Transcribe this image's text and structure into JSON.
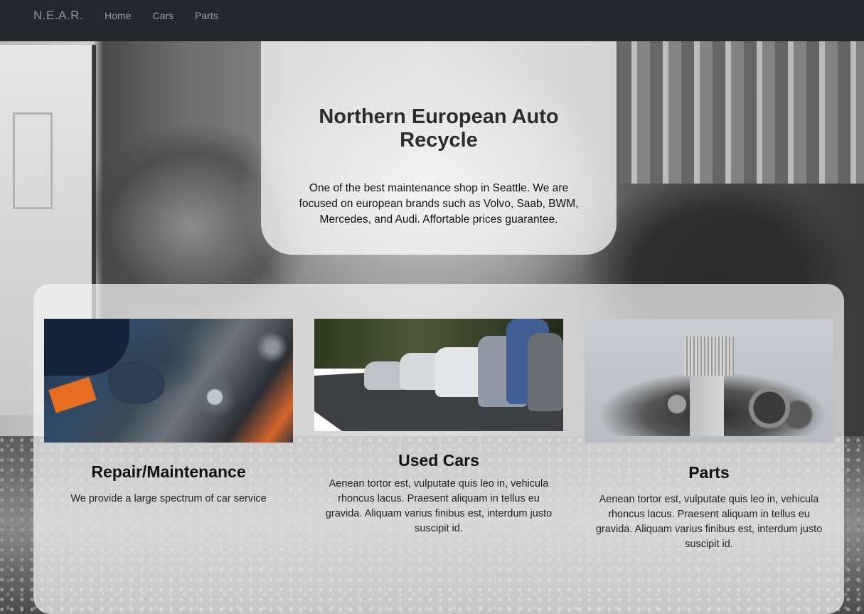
{
  "navbar": {
    "brand": "N.E.A.R.",
    "links": [
      "Home",
      "Cars",
      "Parts"
    ]
  },
  "hero": {
    "title": "Northern European Auto Recycle",
    "description": "One of the best maintenance shop in Seattle. We are focused on european brands such as Volvo, Saab, BWM, Mercedes, and Audi. Affortable prices guarantee."
  },
  "services": [
    {
      "title": "Repair/Maintenance",
      "text": "We provide a large spectrum of car service",
      "image": "engine-repair-photo"
    },
    {
      "title": "Used Cars",
      "text": "Aenean tortor est, vulputate quis leo in, vehicula rhoncus lacus. Praesent aliquam in tellus eu gravida. Aliquam varius finibus est, interdum justo suscipit id.",
      "image": "parked-cars-photo"
    },
    {
      "title": "Parts",
      "text": "Aenean tortor est, vulputate quis leo in, vehicula rhoncus lacus. Praesent aliquam in tellus eu gravida. Aliquam varius finibus est, interdum justo suscipit id.",
      "image": "car-parts-photo"
    }
  ],
  "colors": {
    "navbar_bg": "#23282d",
    "nav_text": "#9aa1a7"
  }
}
